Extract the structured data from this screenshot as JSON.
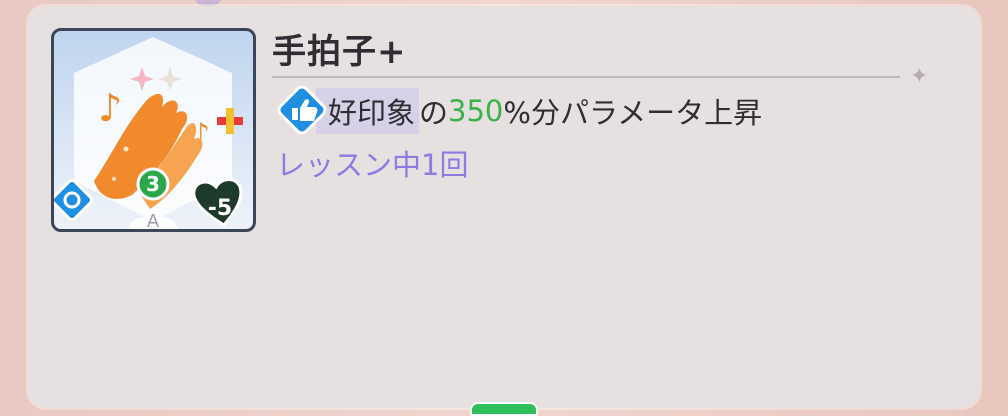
{
  "card": {
    "title": "手拍子+",
    "cost_badge": "3",
    "rarity_label": "A",
    "heart_cost": "-5"
  },
  "effect": {
    "keyword": "好印象",
    "particle": "の",
    "value": "350",
    "suffix": "%分パラメータ上昇"
  },
  "timing": "レッスン中1回",
  "colors": {
    "panel_bg": "#e6e0e1",
    "accent_green": "#39b24a",
    "accent_purple": "#8f7be0",
    "keyword_highlight": "#d6d1e6"
  },
  "icons": [
    "clap-hands-icon",
    "thumbs-up-icon",
    "plus-icon",
    "refresh-icon",
    "heart-icon",
    "sparkle-icon"
  ]
}
